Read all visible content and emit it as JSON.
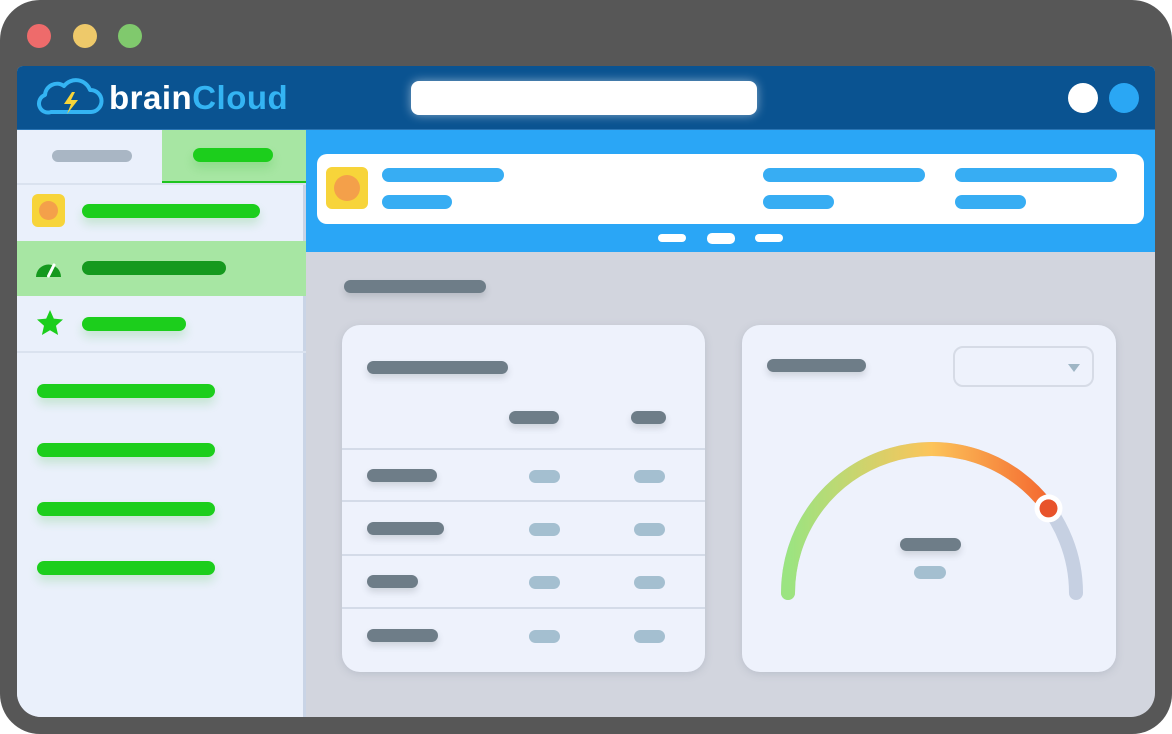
{
  "window": {
    "title": "brainCloud",
    "controls": {
      "close_color": "#ee6b6b",
      "minimize_color": "#eec96a",
      "maximize_color": "#80c96d"
    }
  },
  "header": {
    "brand_part1": "brain",
    "brand_part2": "Cloud",
    "logo_icon": "cloud-lightning-icon",
    "search": {
      "value": "",
      "placeholder": ""
    },
    "buttons": [
      "white-circle-button",
      "blue-circle-button"
    ]
  },
  "sidebar": {
    "tabs": [
      {
        "label": "",
        "active": false
      },
      {
        "label": "",
        "active": true
      }
    ],
    "nav_items": [
      {
        "icon": "app-icon",
        "label": "",
        "active": false
      },
      {
        "icon": "dashboard-gauge-icon",
        "label": "",
        "active": true
      },
      {
        "icon": "star-icon",
        "label": "",
        "active": false
      }
    ],
    "links": [
      "",
      "",
      "",
      ""
    ]
  },
  "main": {
    "notice": {
      "icon": "app-icon",
      "title": "",
      "subtitle": "",
      "stats": [
        {
          "label": "",
          "value": ""
        },
        {
          "label": "",
          "value": ""
        }
      ]
    },
    "carousel": {
      "pages": 3,
      "active_page": 2
    },
    "section_title": "",
    "table_card": {
      "title": "",
      "headers": [
        "",
        ""
      ],
      "rows": [
        [
          "",
          "",
          ""
        ],
        [
          "",
          "",
          ""
        ],
        [
          "",
          "",
          ""
        ],
        [
          "",
          "",
          ""
        ]
      ]
    },
    "gauge_card": {
      "title": "",
      "dropdown": {
        "selected": ""
      },
      "gauge": {
        "value": 0.8,
        "center_label": "",
        "center_sublabel": ""
      },
      "colors": {
        "start": "#9be481",
        "mid": "#fcc45a",
        "end": "#f4682f",
        "track": "#c6d0e2",
        "knob": "#e8532b"
      }
    }
  }
}
